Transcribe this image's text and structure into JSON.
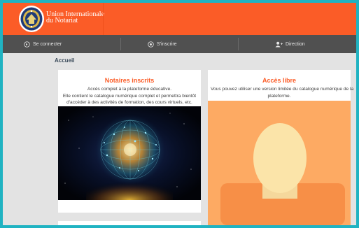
{
  "header": {
    "brand_line1": "Union Internationale",
    "brand_line2": "du Notariat"
  },
  "nav": {
    "login": "Se connecter",
    "register": "S'inscrire",
    "direction": "Direction"
  },
  "breadcrumb": "Accueil",
  "cards": {
    "registered": {
      "title": "Notaires inscrits",
      "line1": "Accès complet à la plateforme éducative.",
      "line2": "Elle contient le catalogue numérique complet et permettra bientôt",
      "line3": "d'accéder à des activités de formation, des cours virtuels, etc."
    },
    "free": {
      "title": "Accès libre",
      "line1": "Vous pouvez utiliser une version limitée du catalogue numérique de la",
      "line2": "plateforme."
    }
  },
  "colors": {
    "brand": "#fb5c27",
    "navbar": "#505050",
    "page_bg": "#e3e3e3",
    "frame": "#20b3c2",
    "avatar_bg": "#fdaa63"
  },
  "icons": [
    "uinl-seal-icon",
    "login-circle-icon",
    "register-circle-icon",
    "user-plus-icon",
    "globe-network-image",
    "avatar-placeholder-image"
  ]
}
